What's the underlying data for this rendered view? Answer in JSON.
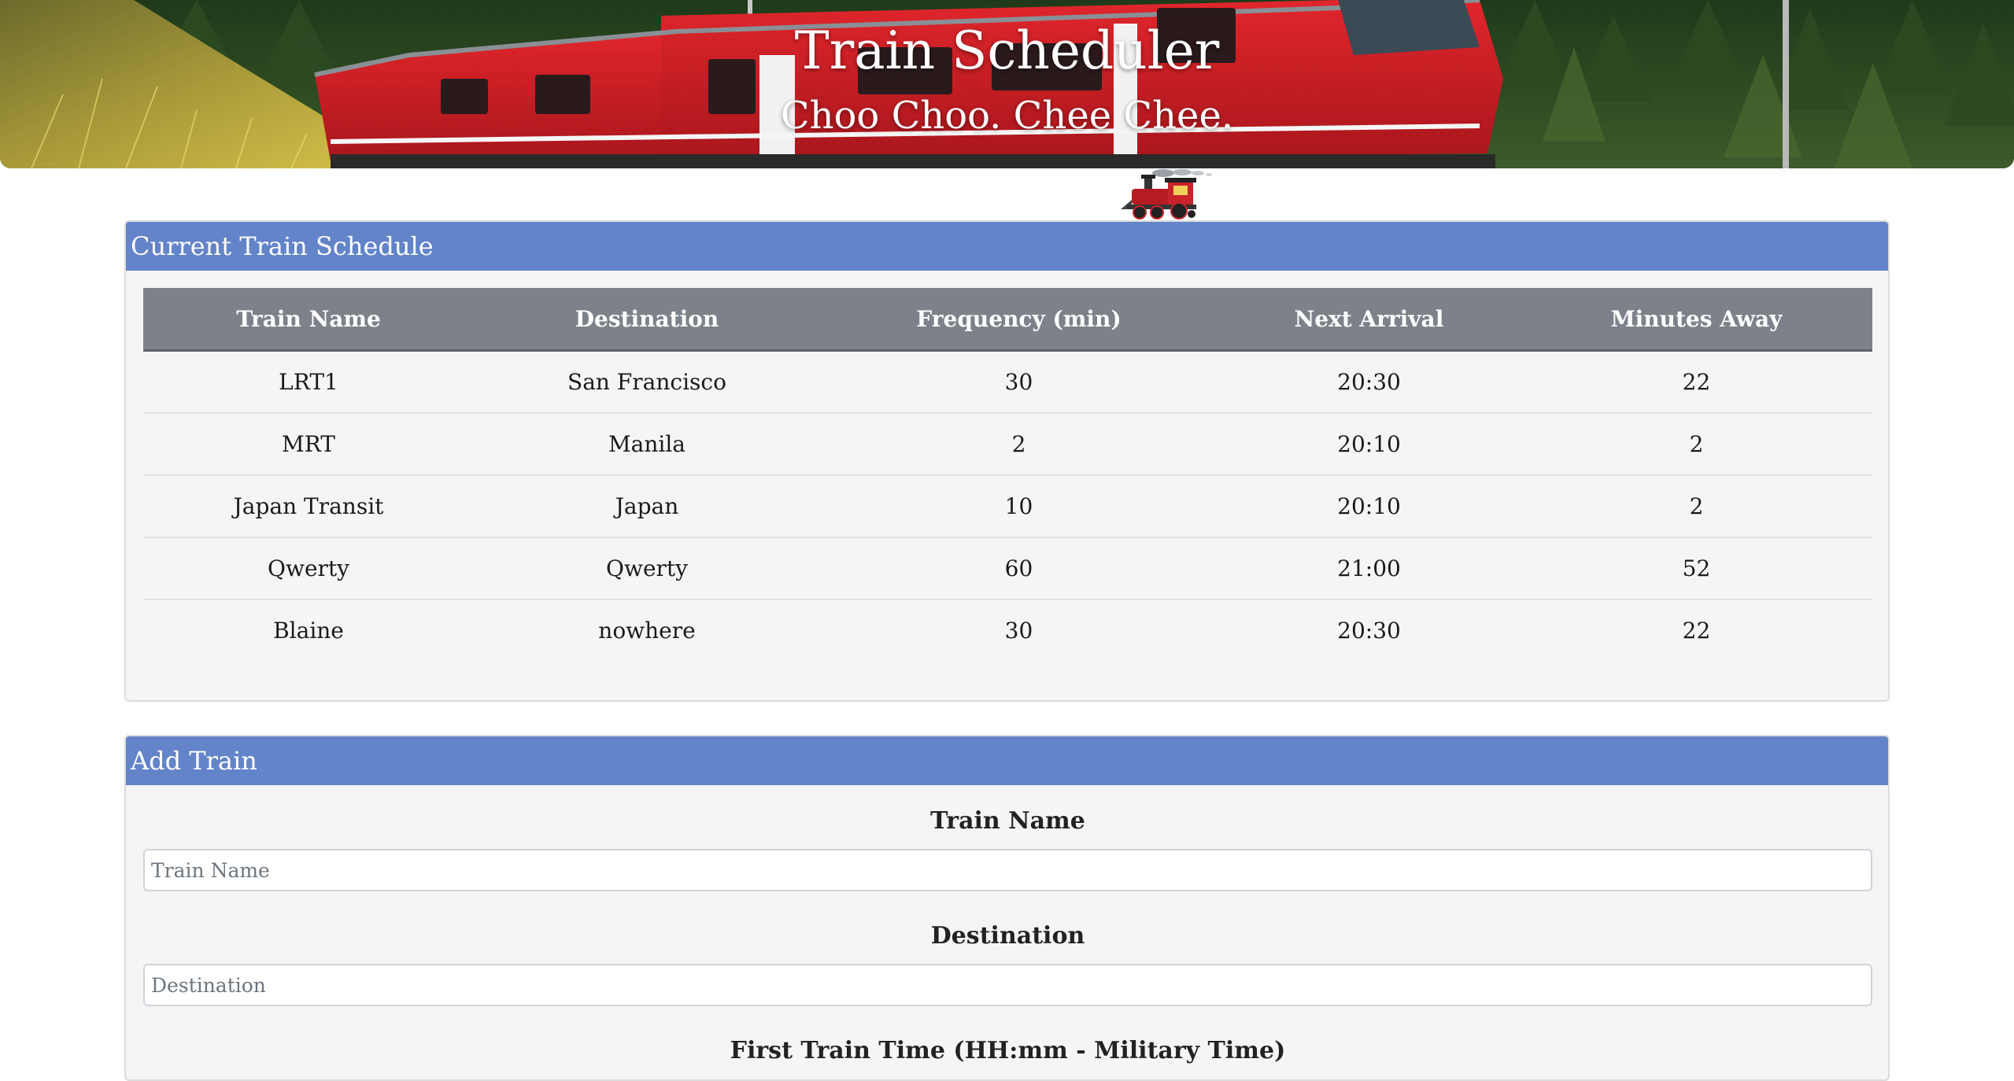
{
  "header": {
    "title": "Train Scheduler",
    "subtitle": "Choo Choo. Chee Chee."
  },
  "schedule": {
    "heading": "Current Train Schedule",
    "columns": [
      "Train Name",
      "Destination",
      "Frequency (min)",
      "Next Arrival",
      "Minutes Away"
    ],
    "rows": [
      {
        "name": "LRT1",
        "destination": "San Francisco",
        "frequency": "30",
        "next_arrival": "20:30",
        "minutes_away": "22"
      },
      {
        "name": "MRT",
        "destination": "Manila",
        "frequency": "2",
        "next_arrival": "20:10",
        "minutes_away": "2"
      },
      {
        "name": "Japan Transit",
        "destination": "Japan",
        "frequency": "10",
        "next_arrival": "20:10",
        "minutes_away": "2"
      },
      {
        "name": "Qwerty",
        "destination": "Qwerty",
        "frequency": "60",
        "next_arrival": "21:00",
        "minutes_away": "52"
      },
      {
        "name": "Blaine",
        "destination": "nowhere",
        "frequency": "30",
        "next_arrival": "20:30",
        "minutes_away": "22"
      }
    ]
  },
  "add_train": {
    "heading": "Add Train",
    "fields": {
      "train_name": {
        "label": "Train Name",
        "placeholder": "Train Name",
        "value": ""
      },
      "destination": {
        "label": "Destination",
        "placeholder": "Destination",
        "value": ""
      },
      "first_train_time": {
        "label": "First Train Time (HH:mm - Military Time)"
      }
    }
  },
  "icons": {
    "banner": "red-train-photo",
    "logo": "steam-locomotive-icon"
  },
  "colors": {
    "panel_heading": "#6384c9",
    "table_header": "#7d828a",
    "panel_body": "#f5f5f5",
    "train_red": "#d8232a"
  }
}
